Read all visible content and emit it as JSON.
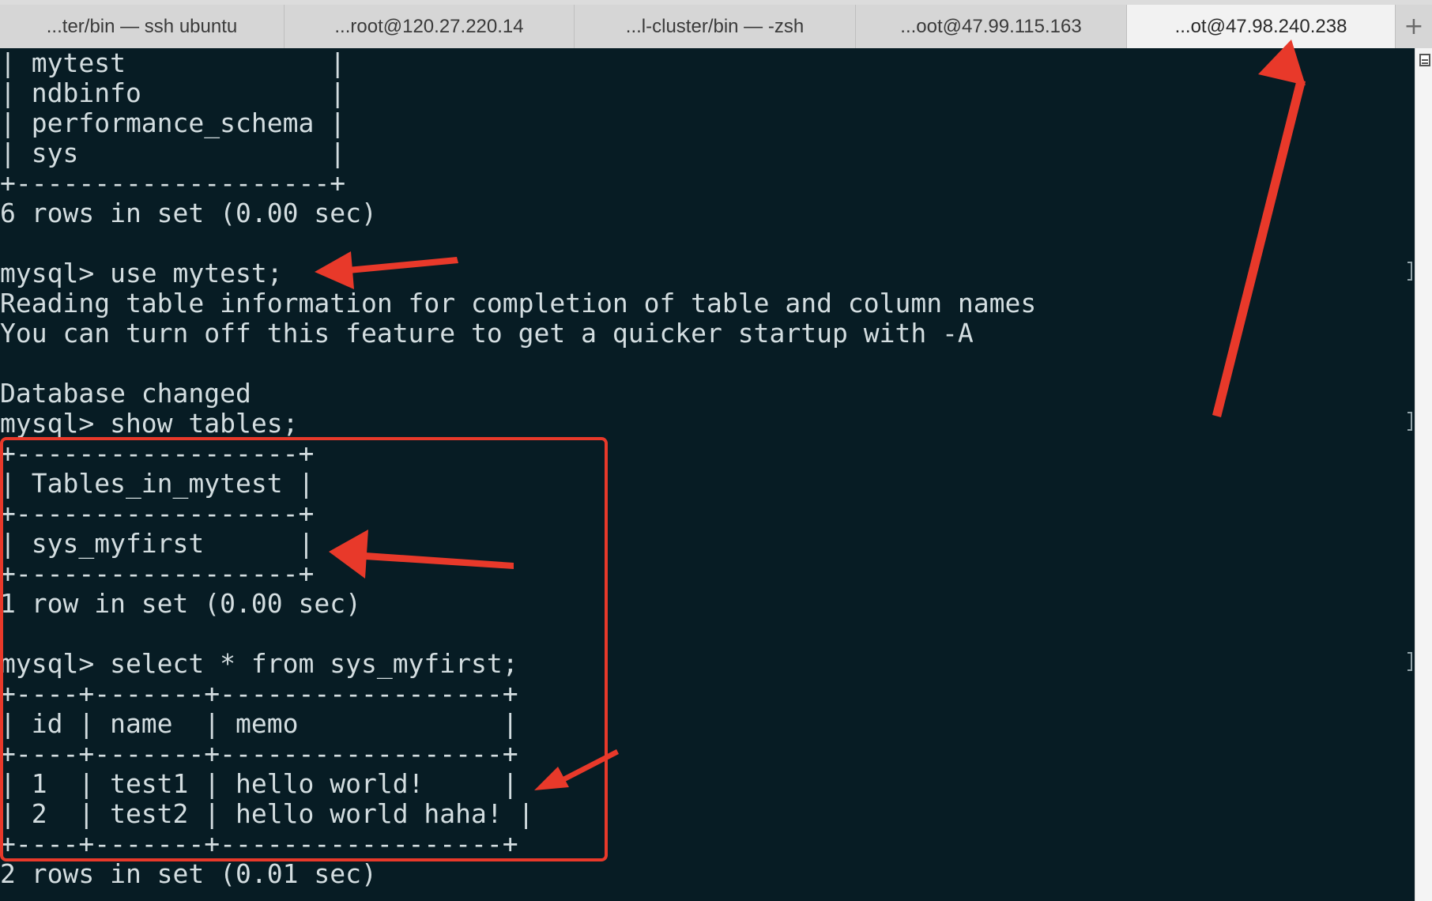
{
  "tabs": [
    {
      "label": "...ter/bin — ssh ubuntu",
      "active": false
    },
    {
      "label": "...root@120.27.220.14",
      "active": false
    },
    {
      "label": "...l-cluster/bin — -zsh",
      "active": false
    },
    {
      "label": "...oot@47.99.115.163",
      "active": false
    },
    {
      "label": "...ot@47.98.240.238",
      "active": true
    }
  ],
  "new_tab_label": "+",
  "terminal": {
    "lines": [
      "| mytest             |",
      "| ndbinfo            |",
      "| performance_schema |",
      "| sys                |",
      "+--------------------+",
      "6 rows in set (0.00 sec)",
      "",
      "mysql> use mytest;",
      "Reading table information for completion of table and column names",
      "You can turn off this feature to get a quicker startup with -A",
      "",
      "Database changed",
      "mysql> show tables;",
      "+------------------+",
      "| Tables_in_mytest |",
      "+------------------+",
      "| sys_myfirst      |",
      "+------------------+",
      "1 row in set (0.00 sec)",
      "",
      "mysql> select * from sys_myfirst;",
      "+----+-------+------------------+",
      "| id | name  | memo             |",
      "+----+-------+------------------+",
      "| 1  | test1 | hello world!     |",
      "| 2  | test2 | hello world haha! |",
      "+----+-------+------------------+",
      "2 rows in set (0.01 sec)"
    ]
  },
  "colors": {
    "terminal_bg": "#071c24",
    "terminal_fg": "#d3dde0",
    "annotation": "#e8392a",
    "tabbar_bg": "#dcdcdc",
    "active_tab_bg": "#f2f2f2"
  },
  "icons": {
    "new_tab": "plus-icon",
    "scrollbar": "scroll-list-icon"
  }
}
